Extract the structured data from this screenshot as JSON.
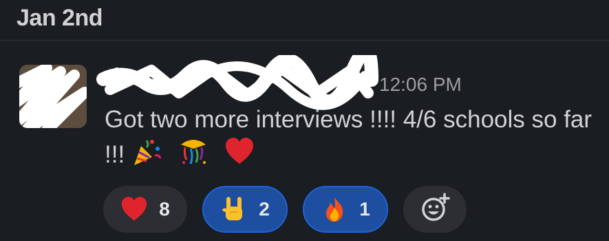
{
  "conversation": {
    "date_label": "Jan 2nd"
  },
  "message": {
    "timestamp": "12:06 PM",
    "text": "Got two more interviews !!!! 4/6 schools so far !!!",
    "trailing_emojis": [
      "party-popper",
      "confetti-ball",
      "red-heart"
    ]
  },
  "reactions": [
    {
      "emoji": "red-heart",
      "count": "8",
      "active": false
    },
    {
      "emoji": "sign-of-the-horns",
      "count": "2",
      "active": true
    },
    {
      "emoji": "fire",
      "count": "1",
      "active": true
    }
  ],
  "add_reaction": {
    "icon": "add-reaction-icon"
  },
  "colors": {
    "background": "#1a1d21",
    "text": "#d1d2d3",
    "timestamp": "#9c9da0",
    "reaction_bg": "#2c2e33",
    "reaction_active_bg": "#1d4ea0",
    "reaction_active_border": "#1e65d8"
  }
}
